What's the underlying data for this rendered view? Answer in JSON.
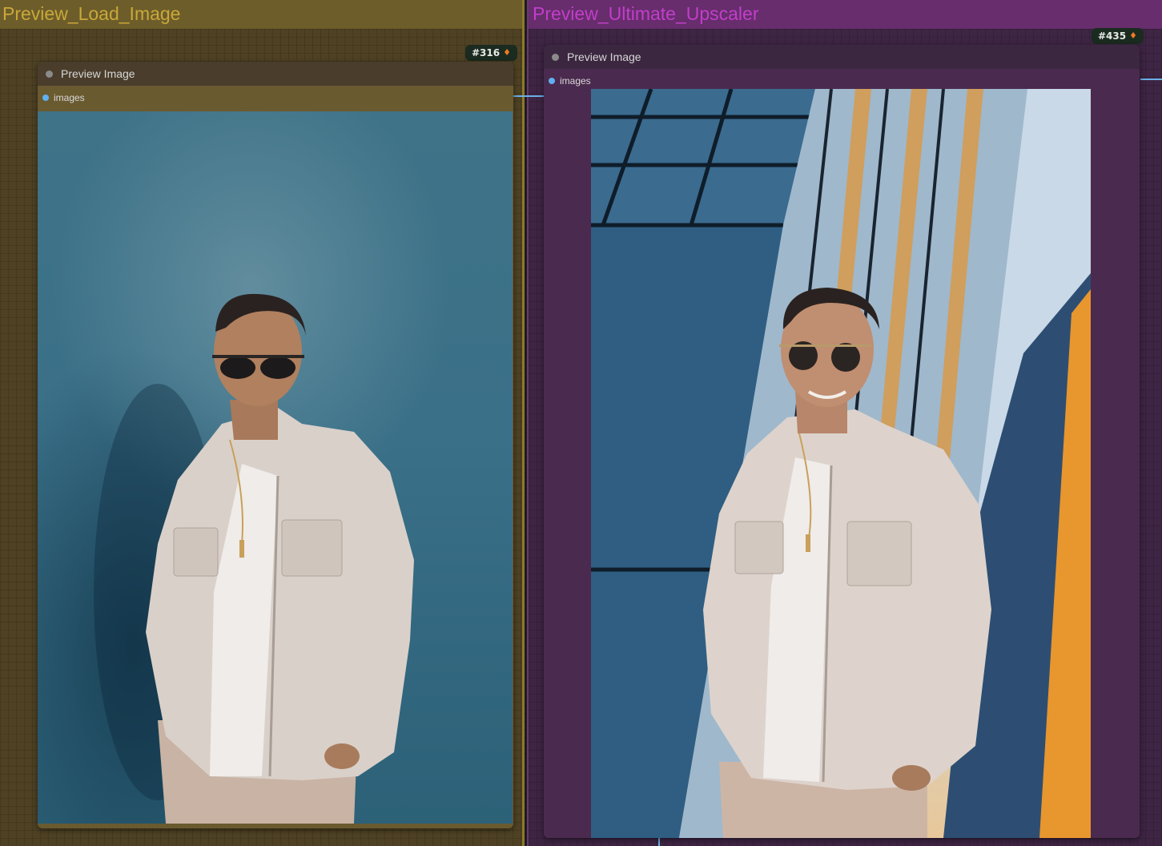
{
  "groups": {
    "left": {
      "title": "Preview_Load_Image"
    },
    "right": {
      "title": "Preview_Ultimate_Upscaler"
    }
  },
  "nodes": {
    "left": {
      "badge": "#316",
      "title": "Preview Image",
      "input_label": "images"
    },
    "right": {
      "badge": "#435",
      "title": "Preview Image",
      "input_label": "images"
    }
  },
  "icons": {
    "badge_icon": "fox-icon",
    "status_dot": "node-status-dot"
  },
  "colors": {
    "left_group": "#6d5d2a",
    "right_group": "#672d6c",
    "left_title_text": "#c9a83a",
    "right_title_text": "#c23ecb",
    "slot": "#5fb0f0"
  }
}
